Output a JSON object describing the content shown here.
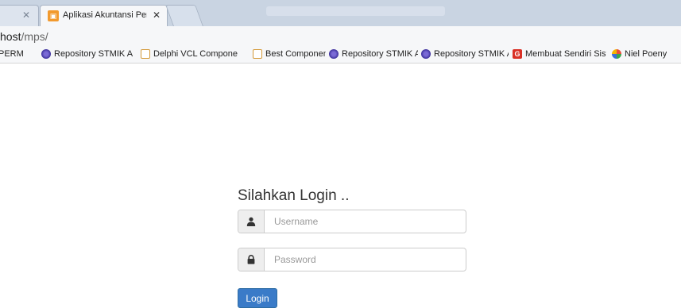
{
  "browser": {
    "tabs": [
      {
        "label": "Aplikasi Akuntansi Perhitu",
        "active": true
      }
    ],
    "address": {
      "host": "host",
      "path": "/mps/"
    },
    "bookmarks": [
      {
        "label": "PERM",
        "icon": "repository-icon"
      },
      {
        "label": "Repository STMIK AM",
        "icon": "repository-icon"
      },
      {
        "label": "Delphi VCL Compone",
        "icon": "components-icon"
      },
      {
        "label": "Best Components Unt",
        "icon": "components-icon"
      },
      {
        "label": "Repository STMIK AM",
        "icon": "repository-icon"
      },
      {
        "label": "Repository STMIK AM",
        "icon": "repository-icon"
      },
      {
        "label": "Membuat Sendiri Sist",
        "icon": "g-icon"
      },
      {
        "label": "Niel Poeny",
        "icon": "colorful-icon"
      }
    ]
  },
  "login": {
    "title": "Silahkan Login ..",
    "username_placeholder": "Username",
    "password_placeholder": "Password",
    "button_label": "Login"
  },
  "colors": {
    "button": "#3a7bc8",
    "tabstrip": "#c9d4e2"
  }
}
